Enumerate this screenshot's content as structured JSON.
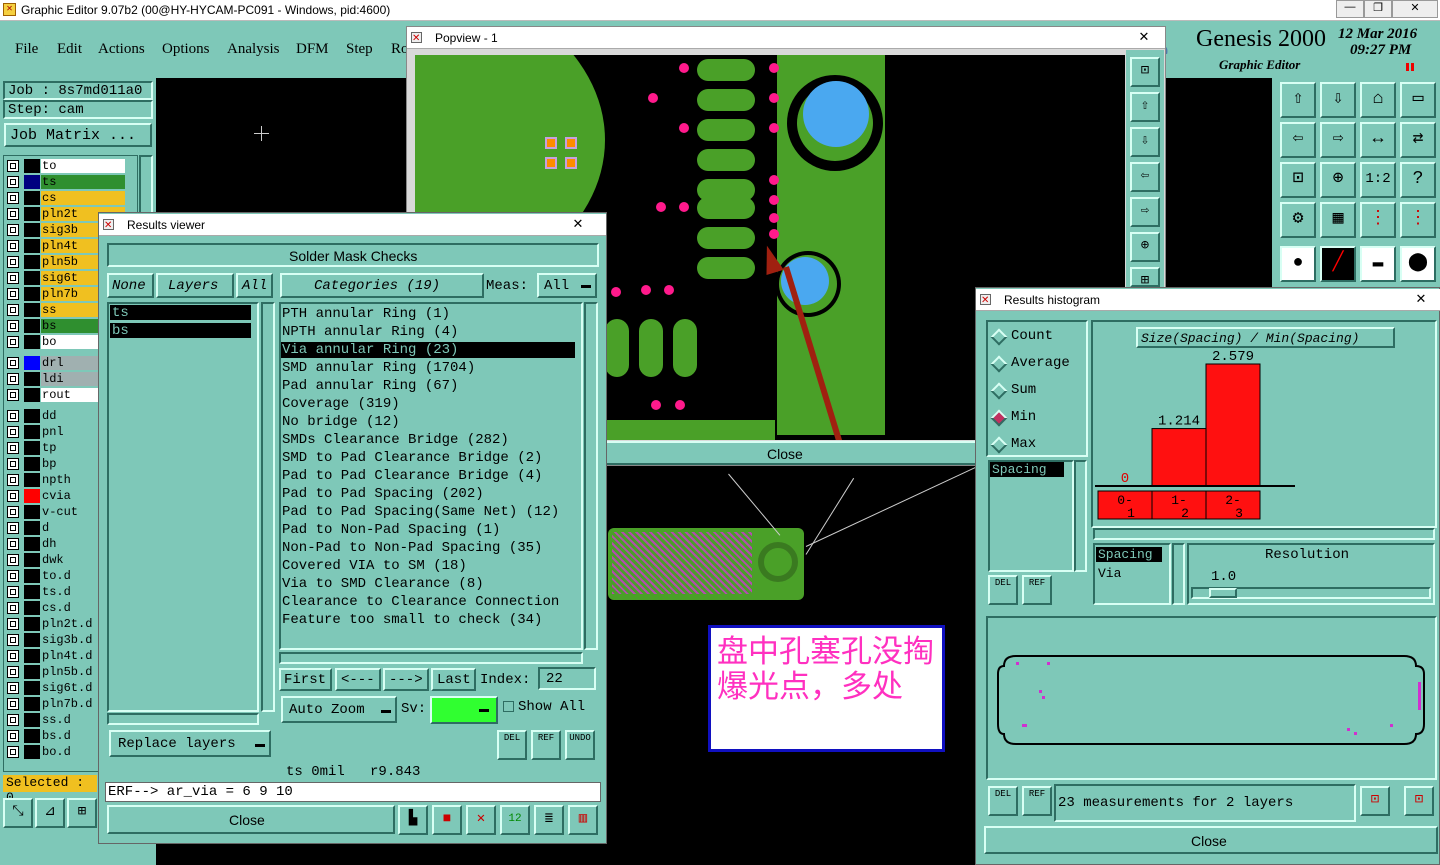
{
  "app": {
    "title": "Graphic Editor 9.07b2 (00@HY-HYCAM-PC091 - Windows, pid:4600)",
    "menu": [
      "File",
      "Edit",
      "Actions",
      "Options",
      "Analysis",
      "DFM",
      "Step",
      "Ro"
    ],
    "brand": "Genesis 2000",
    "brand_sub": "Graphic Editor",
    "date": "12 Mar 2016",
    "time": "09:27 PM",
    "job_label": "Job : 8s7md011a0",
    "step_label": "Step: cam",
    "job_matrix_button": "Job Matrix ...",
    "selected_label": "Selected : 0",
    "window_buttons": [
      "—",
      "❐",
      "✕"
    ]
  },
  "layers": [
    {
      "name": "to",
      "swatch": "#000000",
      "color": "#ffffff"
    },
    {
      "name": "ts",
      "swatch": "#000080",
      "color": "#2f8f2f"
    },
    {
      "name": "cs",
      "swatch": "#000000",
      "color": "#f0c020"
    },
    {
      "name": "pln2t",
      "swatch": "#000000",
      "color": "#f0c020"
    },
    {
      "name": "sig3b",
      "swatch": "#000000",
      "color": "#f0c020"
    },
    {
      "name": "pln4t",
      "swatch": "#000000",
      "color": "#f0c020"
    },
    {
      "name": "pln5b",
      "swatch": "#000000",
      "color": "#f0c020"
    },
    {
      "name": "sig6t",
      "swatch": "#000000",
      "color": "#f0c020"
    },
    {
      "name": "pln7b",
      "swatch": "#000000",
      "color": "#f0c020"
    },
    {
      "name": "ss",
      "swatch": "#000000",
      "color": "#f0c020"
    },
    {
      "name": "bs",
      "swatch": "#000000",
      "color": "#2f8f2f"
    },
    {
      "name": "bo",
      "swatch": "#000000",
      "color": "#ffffff"
    },
    {
      "name": "drl",
      "swatch": "#0000ff",
      "color": "#a0b0b0"
    },
    {
      "name": "ldi",
      "swatch": "#000000",
      "color": "#a0b0b0"
    },
    {
      "name": "rout",
      "swatch": "#000000",
      "color": "#ffffff"
    },
    {
      "name": "dd",
      "swatch": "#000000",
      "color": "#7ec8b8"
    },
    {
      "name": "pnl",
      "swatch": "#000000",
      "color": "#7ec8b8"
    },
    {
      "name": "tp",
      "swatch": "#000000",
      "color": "#7ec8b8"
    },
    {
      "name": "bp",
      "swatch": "#000000",
      "color": "#7ec8b8"
    },
    {
      "name": "npth",
      "swatch": "#000000",
      "color": "#7ec8b8"
    },
    {
      "name": "cvia",
      "swatch": "#ff0000",
      "color": "#7ec8b8"
    },
    {
      "name": "v-cut",
      "swatch": "#000000",
      "color": "#7ec8b8"
    },
    {
      "name": "d",
      "swatch": "#000000",
      "color": "#7ec8b8"
    },
    {
      "name": "dh",
      "swatch": "#000000",
      "color": "#7ec8b8"
    },
    {
      "name": "dwk",
      "swatch": "#000000",
      "color": "#7ec8b8"
    },
    {
      "name": "to.d",
      "swatch": "#000000",
      "color": "#7ec8b8"
    },
    {
      "name": "ts.d",
      "swatch": "#000000",
      "color": "#7ec8b8"
    },
    {
      "name": "cs.d",
      "swatch": "#000000",
      "color": "#7ec8b8"
    },
    {
      "name": "pln2t.d",
      "swatch": "#000000",
      "color": "#7ec8b8"
    },
    {
      "name": "sig3b.d",
      "swatch": "#000000",
      "color": "#7ec8b8"
    },
    {
      "name": "pln4t.d",
      "swatch": "#000000",
      "color": "#7ec8b8"
    },
    {
      "name": "pln5b.d",
      "swatch": "#000000",
      "color": "#7ec8b8"
    },
    {
      "name": "sig6t.d",
      "swatch": "#000000",
      "color": "#7ec8b8"
    },
    {
      "name": "pln7b.d",
      "swatch": "#000000",
      "color": "#7ec8b8"
    },
    {
      "name": "ss.d",
      "swatch": "#000000",
      "color": "#7ec8b8"
    },
    {
      "name": "bs.d",
      "swatch": "#000000",
      "color": "#7ec8b8"
    },
    {
      "name": "bo.d",
      "swatch": "#000000",
      "color": "#7ec8b8"
    }
  ],
  "popview": {
    "title": "Popview - 1",
    "close_label": "Close",
    "annotation": "盘中孔塞孔没掏爆光点，多处"
  },
  "results_viewer": {
    "title": "Results viewer",
    "header": "Solder Mask Checks",
    "none_label": "None",
    "layers_label": "Layers",
    "all_label": "All",
    "categories_label": "Categories (19)",
    "meas_label": "Meas:",
    "meas_value": "All",
    "selected_layers": [
      "ts",
      "bs"
    ],
    "categories": [
      "PTH annular Ring (1)",
      "NPTH annular Ring (4)",
      "Via annular Ring (23)",
      "SMD annular Ring (1704)",
      "Pad annular Ring (67)",
      "Coverage (319)",
      "No bridge (12)",
      "SMDs Clearance Bridge (282)",
      "SMD to Pad Clearance Bridge (2)",
      "Pad to Pad Clearance Bridge (4)",
      "Pad to Pad Spacing (202)",
      "Pad to Pad Spacing(Same Net) (12)",
      "Pad to Non-Pad Spacing (1)",
      "Non-Pad to Non-Pad Spacing (35)",
      "Covered VIA to SM (18)",
      "Via to SMD Clearance (8)",
      "Clearance to Clearance Connection",
      "Feature too small to check (34)"
    ],
    "selected_index": 2,
    "first_label": "First",
    "prev_label": "<---",
    "next_label": "--->",
    "last_label": "Last",
    "index_label": "Index:",
    "index_value": "22",
    "auto_zoom_label": "Auto Zoom",
    "sv_label": "Sv:",
    "show_all_label": "Show All",
    "replace_layers_label": "Replace layers",
    "status_line": "ts 0mil   r9.843",
    "erf_line": "ERF--> ar_via = 6 9 10",
    "close_label": "Close",
    "del_label": "DEL",
    "ref_label": "REF",
    "undo_label": "UNDO"
  },
  "histogram": {
    "title": "Results histogram",
    "modes": [
      "Count",
      "Average",
      "Sum",
      "Min",
      "Max"
    ],
    "selected_mode": "Min",
    "chart_title": "Size(Spacing) / Min(Spacing)",
    "bars": [
      {
        "label": "0-1",
        "top": "0-",
        "bottom": "1",
        "value": 0,
        "value_label": "0"
      },
      {
        "label": "1-2",
        "top": "1-",
        "bottom": "2",
        "value": 1.214,
        "value_label": "1.214"
      },
      {
        "label": "2-3",
        "top": "2-",
        "bottom": "3",
        "value": 2.579,
        "value_label": "2.579"
      }
    ],
    "list_item": "Spacing",
    "list2": [
      "Spacing",
      "Via"
    ],
    "resolution_label": "Resolution",
    "resolution_value": "1.0",
    "measurements": "23 measurements for 2 layers",
    "close_label": "Close",
    "del_label": "DEL",
    "ref_label": "REF"
  },
  "colors": {
    "panel": "#7ec8b8",
    "board_green": "#4aa028",
    "pad_pink": "#ff1a8c",
    "hole_blue": "#4aa8f0",
    "bar_red": "#ff1010"
  }
}
